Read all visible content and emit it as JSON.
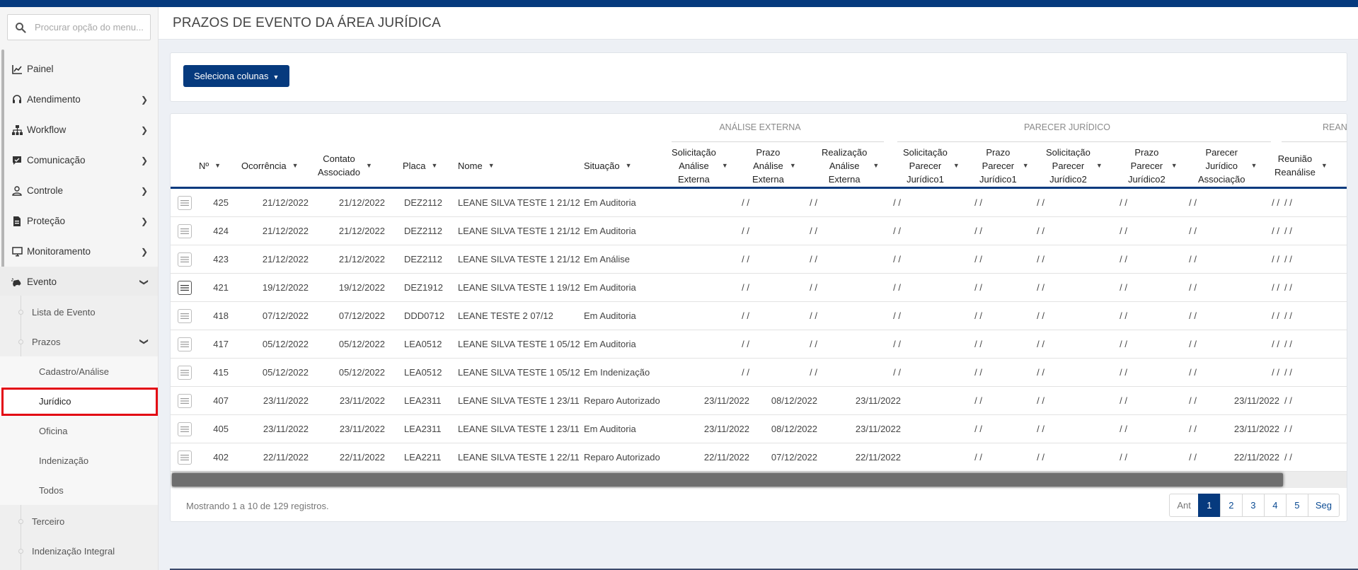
{
  "search": {
    "placeholder": "Procurar opção do menu..."
  },
  "sidebar": {
    "items": [
      {
        "label": "Painel",
        "icon": "chart-line-icon"
      },
      {
        "label": "Atendimento",
        "icon": "headset-icon"
      },
      {
        "label": "Workflow",
        "icon": "sitemap-icon"
      },
      {
        "label": "Comunicação",
        "icon": "chat-icon"
      },
      {
        "label": "Controle",
        "icon": "user-icon"
      },
      {
        "label": "Proteção",
        "icon": "document-icon"
      },
      {
        "label": "Monitoramento",
        "icon": "monitor-icon"
      },
      {
        "label": "Evento",
        "icon": "car-crash-icon"
      }
    ],
    "evento_sub": [
      {
        "label": "Lista de Evento"
      },
      {
        "label": "Prazos"
      }
    ],
    "prazos_sub": [
      {
        "label": "Cadastro/Análise"
      },
      {
        "label": "Jurídico"
      },
      {
        "label": "Oficina"
      },
      {
        "label": "Indenização"
      },
      {
        "label": "Todos"
      }
    ],
    "evento_sub_more": [
      {
        "label": "Terceiro"
      },
      {
        "label": "Indenização Integral"
      }
    ]
  },
  "page": {
    "title": "PRAZOS DE EVENTO DA ÁREA JURÍDICA"
  },
  "toolbar": {
    "select_columns_label": "Seleciona colunas"
  },
  "table": {
    "groups": [
      "ANÁLISE EXTERNA",
      "PARECER JURÍDICO",
      "REAN"
    ],
    "columns": [
      "Nº",
      "Ocorrência",
      "Contato\nAssociado",
      "Placa",
      "Nome",
      "Situação",
      "Solicitação\nAnálise\nExterna",
      "Prazo\nAnálise\nExterna",
      "Realização\nAnálise\nExterna",
      "Solicitação\nParecer\nJurídico1",
      "Prazo\nParecer\nJurídico1",
      "Solicitação\nParecer\nJurídico2",
      "Prazo\nParecer\nJurídico2",
      "Parecer\nJurídico\nAssociação",
      "Reunião\nReanálise"
    ],
    "rows": [
      [
        "425",
        "21/12/2022",
        "21/12/2022",
        "DEZ2112",
        "LEANE SILVA TESTE 1 21/12",
        "Em Auditoria",
        "/ /",
        "/ /",
        "/ /",
        "/ /",
        "/ /",
        "/ /",
        "/ /",
        "/ /",
        "/ /"
      ],
      [
        "424",
        "21/12/2022",
        "21/12/2022",
        "DEZ2112",
        "LEANE SILVA TESTE 1 21/12",
        "Em Auditoria",
        "/ /",
        "/ /",
        "/ /",
        "/ /",
        "/ /",
        "/ /",
        "/ /",
        "/ /",
        "/ /"
      ],
      [
        "423",
        "21/12/2022",
        "21/12/2022",
        "DEZ2112",
        "LEANE SILVA TESTE 1 21/12",
        "Em Análise",
        "/ /",
        "/ /",
        "/ /",
        "/ /",
        "/ /",
        "/ /",
        "/ /",
        "/ /",
        "/ /"
      ],
      [
        "421",
        "19/12/2022",
        "19/12/2022",
        "DEZ1912",
        "LEANE SILVA TESTE 1 19/12",
        "Em Auditoria",
        "/ /",
        "/ /",
        "/ /",
        "/ /",
        "/ /",
        "/ /",
        "/ /",
        "/ /",
        "/ /"
      ],
      [
        "418",
        "07/12/2022",
        "07/12/2022",
        "DDD0712",
        "LEANE TESTE 2 07/12",
        "Em Auditoria",
        "/ /",
        "/ /",
        "/ /",
        "/ /",
        "/ /",
        "/ /",
        "/ /",
        "/ /",
        "/ /"
      ],
      [
        "417",
        "05/12/2022",
        "05/12/2022",
        "LEA0512",
        "LEANE SILVA TESTE 1 05/12",
        "Em Auditoria",
        "/ /",
        "/ /",
        "/ /",
        "/ /",
        "/ /",
        "/ /",
        "/ /",
        "/ /",
        "/ /"
      ],
      [
        "415",
        "05/12/2022",
        "05/12/2022",
        "LEA0512",
        "LEANE SILVA TESTE 1 05/12",
        "Em Indenização",
        "/ /",
        "/ /",
        "/ /",
        "/ /",
        "/ /",
        "/ /",
        "/ /",
        "/ /",
        "/ /"
      ],
      [
        "407",
        "23/11/2022",
        "23/11/2022",
        "LEA2311",
        "LEANE SILVA TESTE 1 23/11",
        "Reparo Autorizado",
        "23/11/2022",
        "08/12/2022",
        "23/11/2022",
        "/ /",
        "/ /",
        "/ /",
        "/ /",
        "23/11/2022",
        "/ /"
      ],
      [
        "405",
        "23/11/2022",
        "23/11/2022",
        "LEA2311",
        "LEANE SILVA TESTE 1 23/11",
        "Em Auditoria",
        "23/11/2022",
        "08/12/2022",
        "23/11/2022",
        "/ /",
        "/ /",
        "/ /",
        "/ /",
        "23/11/2022",
        "/ /"
      ],
      [
        "402",
        "22/11/2022",
        "22/11/2022",
        "LEA2211",
        "LEANE SILVA TESTE 1 22/11",
        "Reparo Autorizado",
        "22/11/2022",
        "07/12/2022",
        "22/11/2022",
        "/ /",
        "/ /",
        "/ /",
        "/ /",
        "22/11/2022",
        "/ /"
      ]
    ]
  },
  "footer": {
    "info": "Mostrando 1 a 10 de 129 registros.",
    "pagination": {
      "prev": "Ant",
      "pages": [
        "1",
        "2",
        "3",
        "4",
        "5"
      ],
      "next": "Seg",
      "current": "1"
    }
  },
  "colors": {
    "primary": "#063a7e",
    "highlight": "#e30613"
  }
}
